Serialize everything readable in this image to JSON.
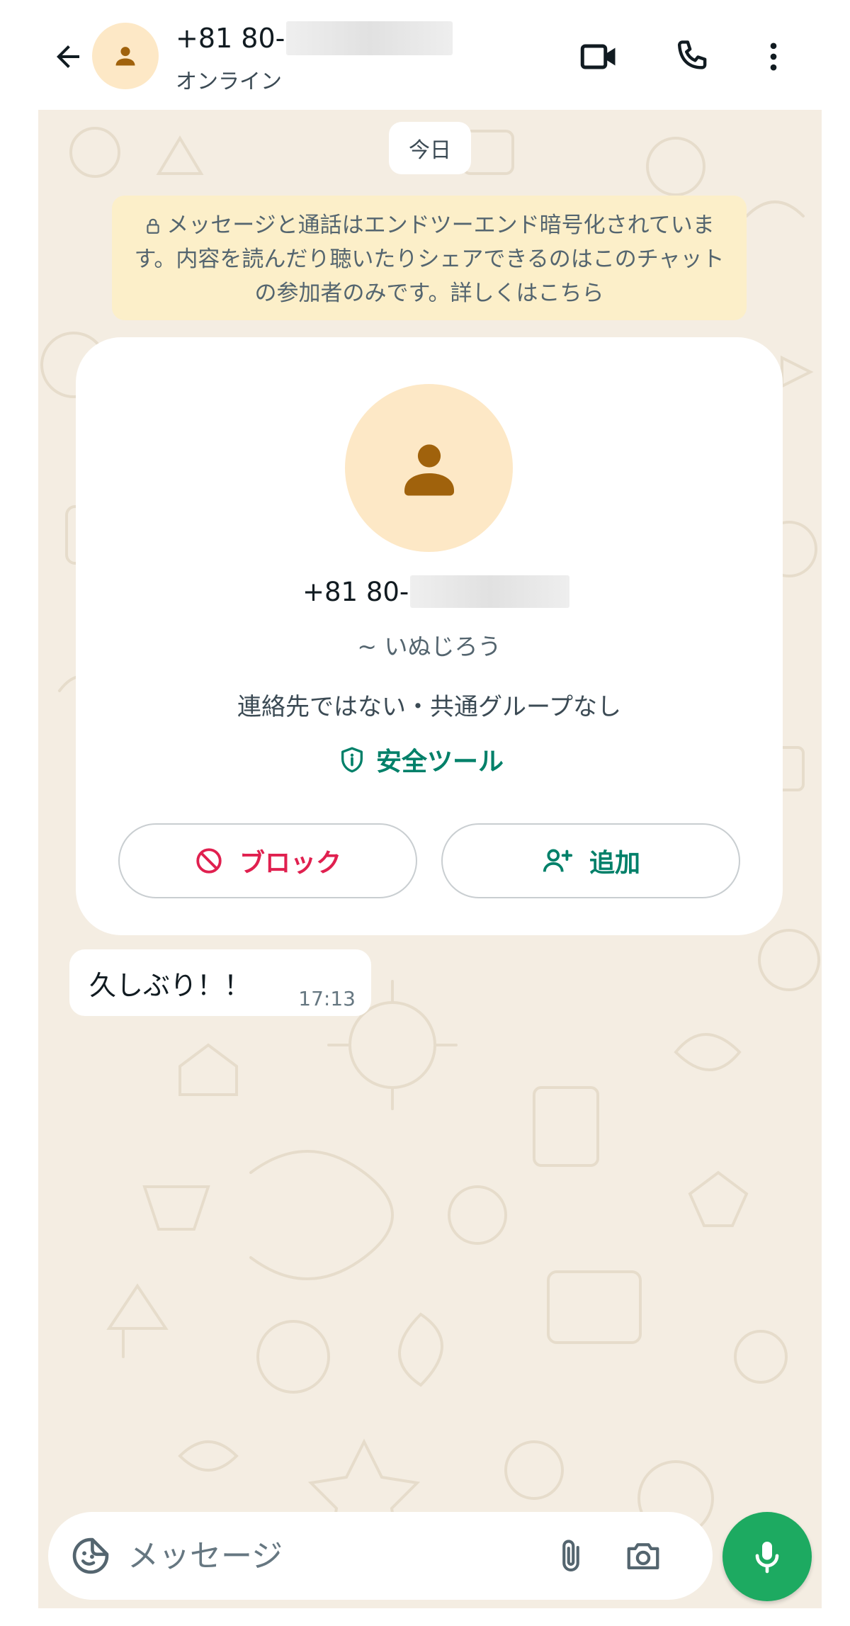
{
  "header": {
    "back_icon": "arrow-left-icon",
    "contact_number_prefix": "+81 80-",
    "status": "オンライン",
    "video_call_icon": "video-camera-icon",
    "voice_call_icon": "phone-icon",
    "menu_icon": "more-vertical-icon"
  },
  "chat": {
    "date_chip": "今日",
    "encryption_notice": "メッセージと通話はエンドツーエンド暗号化されています。内容を読んだり聴いたりシェアできるのはこのチャットの参加者のみです。詳しくはこちら",
    "contact_card": {
      "number_prefix": "+81 80-",
      "nickname": "~ いぬじろう",
      "info": "連絡先ではない・共通グループなし",
      "safety_tools_label": "安全ツール",
      "block_label": "ブロック",
      "add_label": "追加"
    },
    "messages": [
      {
        "text": "久しぶり！！",
        "time": "17:13",
        "direction": "incoming"
      }
    ]
  },
  "composer": {
    "placeholder": "メッセージ",
    "sticker_icon": "sticker-icon",
    "attach_icon": "paperclip-icon",
    "camera_icon": "camera-icon",
    "mic_icon": "microphone-icon"
  },
  "colors": {
    "accent_green": "#008069",
    "mic_green": "#1daa61",
    "block_red": "#e0204f",
    "chat_background": "#f4ede2",
    "notice_background": "#fcefc9",
    "avatar_background": "#fde8c6",
    "avatar_figure": "#a0620c"
  }
}
